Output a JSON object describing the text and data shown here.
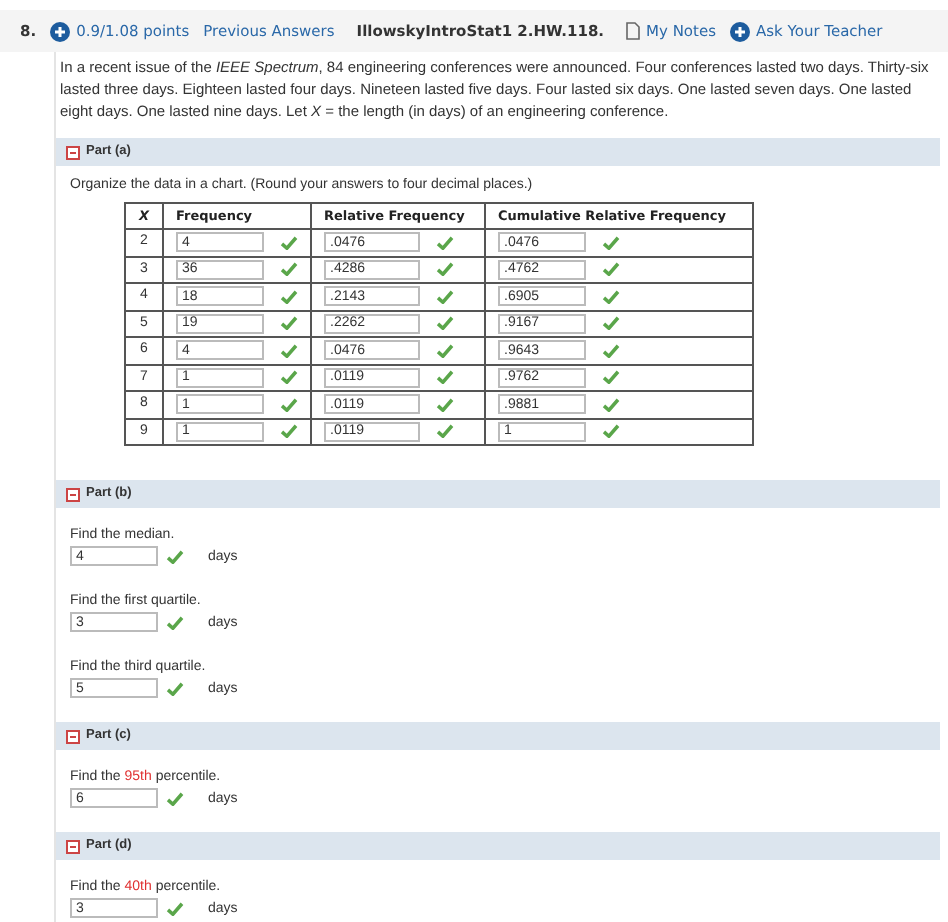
{
  "header": {
    "number": "8.",
    "points": "0.9/1.08 points",
    "previous": "Previous Answers",
    "assignment": "IllowskyIntroStat1 2.HW.118.",
    "notes": "My Notes",
    "ask": "Ask Your Teacher"
  },
  "question": "In a recent issue of the *IEEE Spectrum*, 84 engineering conferences were announced. Four conferences lasted two days. Thirty-six lasted three days. Eighteen lasted four days. Nineteen lasted five days. Four lasted six days. One lasted seven days. One lasted eight days. One lasted nine days. Let *X* = the length (in days) of an engineering conference.",
  "parts": [
    {
      "label": "Part (a)",
      "expanded": true,
      "kind": "table",
      "instruction": "Organize the data in a chart. (Round your answers to four decimal places.)",
      "columns": [
        "X",
        "Frequency",
        "Relative Frequency",
        "Cumulative Relative Frequency"
      ],
      "rows": [
        {
          "cells": [
            {
              "kind": "text",
              "value": "2"
            },
            {
              "kind": "answer",
              "value": "4",
              "correct": true
            },
            {
              "kind": "answer",
              "value": ".0476",
              "correct": true
            },
            {
              "kind": "answer",
              "value": ".0476",
              "correct": true
            }
          ]
        },
        {
          "cells": [
            {
              "kind": "text",
              "value": "3"
            },
            {
              "kind": "answer",
              "value": "36",
              "correct": true
            },
            {
              "kind": "answer",
              "value": ".4286",
              "correct": true
            },
            {
              "kind": "answer",
              "value": ".4762",
              "correct": true
            }
          ]
        },
        {
          "cells": [
            {
              "kind": "text",
              "value": "4"
            },
            {
              "kind": "answer",
              "value": "18",
              "correct": true
            },
            {
              "kind": "answer",
              "value": ".2143",
              "correct": true
            },
            {
              "kind": "answer",
              "value": ".6905",
              "correct": true
            }
          ]
        },
        {
          "cells": [
            {
              "kind": "text",
              "value": "5"
            },
            {
              "kind": "answer",
              "value": "19",
              "correct": true
            },
            {
              "kind": "answer",
              "value": ".2262",
              "correct": true
            },
            {
              "kind": "answer",
              "value": ".9167",
              "correct": true
            }
          ]
        },
        {
          "cells": [
            {
              "kind": "text",
              "value": "6"
            },
            {
              "kind": "answer",
              "value": "4",
              "correct": true
            },
            {
              "kind": "answer",
              "value": ".0476",
              "correct": true
            },
            {
              "kind": "answer",
              "value": ".9643",
              "correct": true
            }
          ]
        },
        {
          "cells": [
            {
              "kind": "text",
              "value": "7"
            },
            {
              "kind": "answer",
              "value": "1",
              "correct": true
            },
            {
              "kind": "answer",
              "value": ".0119",
              "correct": true
            },
            {
              "kind": "answer",
              "value": ".9762",
              "correct": true
            }
          ]
        },
        {
          "cells": [
            {
              "kind": "text",
              "value": "8"
            },
            {
              "kind": "answer",
              "value": "1",
              "correct": true
            },
            {
              "kind": "answer",
              "value": ".0119",
              "correct": true
            },
            {
              "kind": "answer",
              "value": ".9881",
              "correct": true
            }
          ]
        },
        {
          "cells": [
            {
              "kind": "text",
              "value": "9"
            },
            {
              "kind": "answer",
              "value": "1",
              "correct": true
            },
            {
              "kind": "answer",
              "value": ".0119",
              "correct": true
            },
            {
              "kind": "answer",
              "value": "1",
              "correct": true
            }
          ]
        }
      ]
    },
    {
      "label": "Part (b)",
      "expanded": true,
      "kind": "questions",
      "questions": [
        {
          "prompt": [
            {
              "text": "Find the median.",
              "highlight": false
            }
          ],
          "value": "4",
          "correct": true,
          "unit": "days"
        },
        {
          "prompt": [
            {
              "text": "Find the first quartile.",
              "highlight": false
            }
          ],
          "value": "3",
          "correct": true,
          "unit": "days"
        },
        {
          "prompt": [
            {
              "text": "Find the third quartile.",
              "highlight": false
            }
          ],
          "value": "5",
          "correct": true,
          "unit": "days"
        }
      ]
    },
    {
      "label": "Part (c)",
      "expanded": true,
      "kind": "questions",
      "questions": [
        {
          "prompt": [
            {
              "text": "Find the ",
              "highlight": false
            },
            {
              "text": "95th",
              "highlight": true
            },
            {
              "text": " percentile.",
              "highlight": false
            }
          ],
          "value": "6",
          "correct": true,
          "unit": "days"
        }
      ]
    },
    {
      "label": "Part (d)",
      "expanded": true,
      "kind": "questions",
      "questions": [
        {
          "prompt": [
            {
              "text": "Find the ",
              "highlight": false
            },
            {
              "text": "40th",
              "highlight": true
            },
            {
              "text": " percentile.",
              "highlight": false
            }
          ],
          "value": "3",
          "correct": true,
          "unit": "days"
        }
      ]
    }
  ]
}
